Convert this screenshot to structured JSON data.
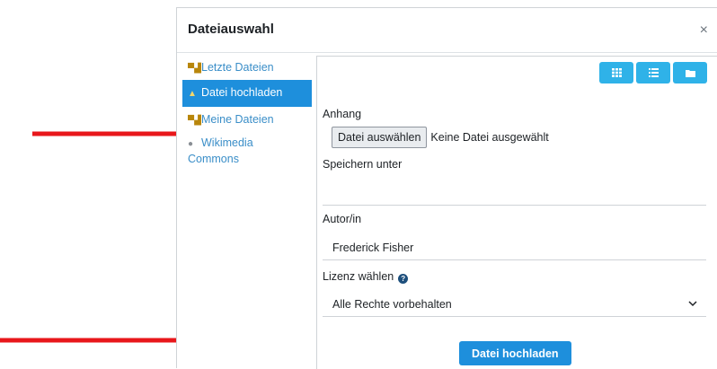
{
  "dialog": {
    "title": "Dateiauswahl",
    "close_glyph": "×"
  },
  "sidebar": {
    "items": [
      {
        "label": "Letzte Dateien",
        "icon": "files-icon",
        "active": false
      },
      {
        "label": "Datei hochladen",
        "icon": "upload-icon",
        "active": true
      },
      {
        "label": "Meine Dateien",
        "icon": "files-icon",
        "active": false
      },
      {
        "label": "Wikimedia Commons",
        "icon": "globe-icon",
        "active": false
      }
    ]
  },
  "toolbar": {
    "views": [
      "grid-view-icon",
      "list-view-icon",
      "folder-view-icon"
    ]
  },
  "form": {
    "attachment_label": "Anhang",
    "choose_file_button": "Datei auswählen",
    "no_file_text": "Keine Datei ausgewählt",
    "save_as_label": "Speichern unter",
    "save_as_value": "",
    "author_label": "Autor/in",
    "author_value": "Frederick Fisher",
    "license_label": "Lizenz wählen",
    "license_value": "Alle Rechte vorbehalten",
    "submit_label": "Datei hochladen"
  },
  "colors": {
    "primary": "#1e8fdc",
    "view_buttons": "#2fb2e8",
    "annotation_arrow": "#e8171b"
  }
}
